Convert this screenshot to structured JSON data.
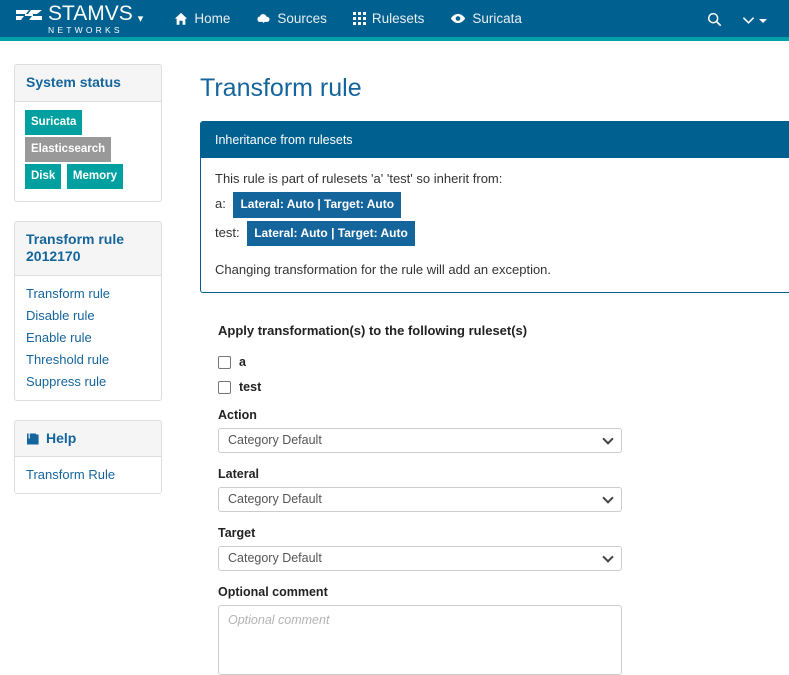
{
  "navbar": {
    "brand": {
      "name": "STAMVS",
      "sub": "NETWORKS",
      "logo_icon": "stamus-logo-icon",
      "caret_icon": "chevron-down-icon"
    },
    "items": [
      {
        "label": "Home",
        "icon": "home-icon"
      },
      {
        "label": "Sources",
        "icon": "cloud-download-icon"
      },
      {
        "label": "Rulesets",
        "icon": "grid-icon"
      },
      {
        "label": "Suricata",
        "icon": "eye-icon"
      }
    ],
    "right": {
      "search_icon": "search-icon",
      "user_menu_icon": "chevron-down-icon",
      "user_menu_caret": "caret-down-icon"
    }
  },
  "sidebar": {
    "system_status": {
      "title": "System status",
      "badges": [
        {
          "label": "Suricata",
          "color": "teal"
        },
        {
          "label": "Elasticsearch",
          "color": "gray"
        },
        {
          "label": "Disk",
          "color": "teal"
        },
        {
          "label": "Memory",
          "color": "teal"
        }
      ]
    },
    "rule_panel": {
      "title": "Transform rule 2012170",
      "items": [
        {
          "label": "Transform rule"
        },
        {
          "label": "Disable rule"
        },
        {
          "label": "Enable rule"
        },
        {
          "label": "Threshold rule"
        },
        {
          "label": "Suppress rule"
        }
      ]
    },
    "help_panel": {
      "title": "Help",
      "icon": "book-icon",
      "items": [
        {
          "label": "Transform Rule"
        }
      ]
    }
  },
  "main": {
    "page_title": "Transform rule",
    "inheritance": {
      "header": "Inheritance from rulesets",
      "intro": "This rule is part of rulesets 'a' 'test' so inherit from:",
      "rows": [
        {
          "key": "a:",
          "badge": "Lateral: Auto | Target: Auto"
        },
        {
          "key": "test:",
          "badge": "Lateral: Auto | Target: Auto"
        }
      ],
      "note": "Changing transformation for the rule will add an exception."
    },
    "form": {
      "title": "Apply transformation(s) to the following ruleset(s)",
      "checkboxes": [
        {
          "label": "a",
          "checked": false
        },
        {
          "label": "test",
          "checked": false
        }
      ],
      "fields": [
        {
          "label": "Action",
          "value": "Category Default"
        },
        {
          "label": "Lateral",
          "value": "Category Default"
        },
        {
          "label": "Target",
          "value": "Category Default"
        }
      ],
      "comment": {
        "label": "Optional comment",
        "placeholder": "Optional comment",
        "value": ""
      }
    }
  },
  "colors": {
    "navbar_bg": "#00608f",
    "navbar_border": "#00a0a8",
    "accent_blue": "#15659d",
    "badge_teal": "#00a0a0",
    "badge_gray": "#999999"
  }
}
